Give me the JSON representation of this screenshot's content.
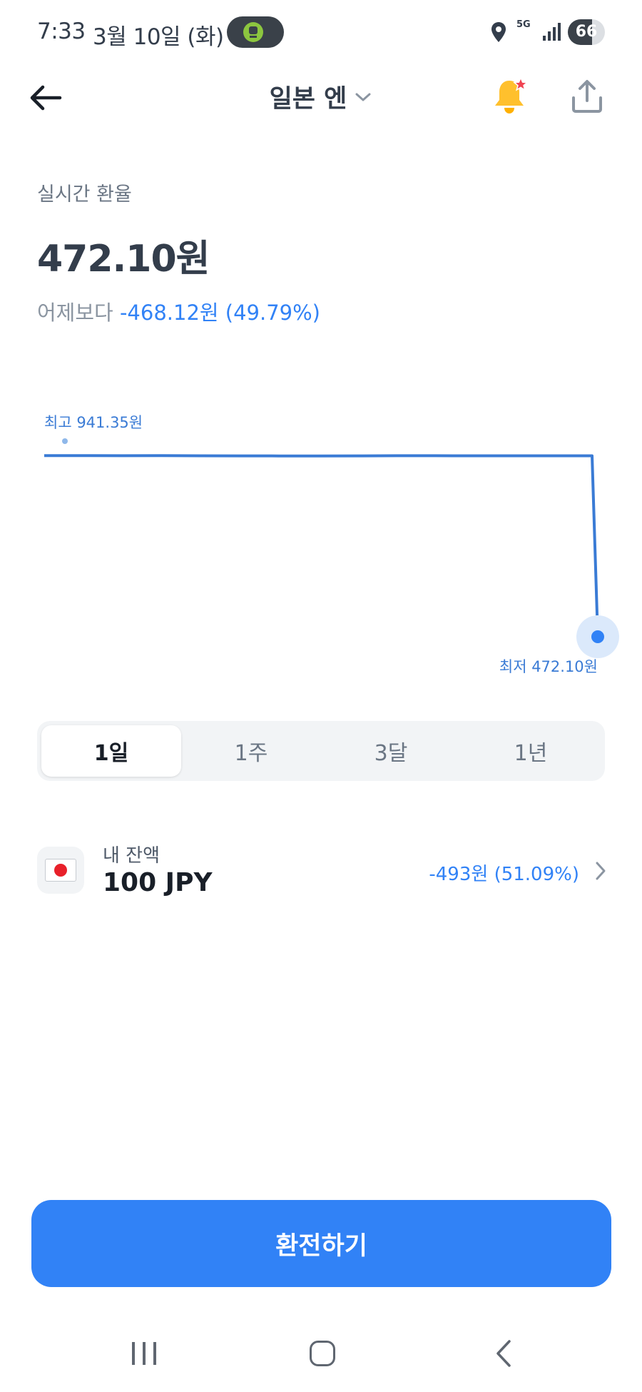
{
  "status_bar": {
    "time": "7:33",
    "date": "3월 10일 (화)",
    "network": "5G",
    "battery": "66",
    "battery_level": 0.66
  },
  "header": {
    "title": "일본 엔"
  },
  "rate": {
    "label": "실시간 환율",
    "value": "472.10원",
    "compare_label": "어제보다",
    "change": "-468.12원 (49.79%)"
  },
  "chart_data": {
    "type": "line",
    "high_label": "최고 941.35원",
    "low_label": "최저 472.10원",
    "high": 941.35,
    "low": 472.1,
    "series": [
      {
        "values": [
          940.9,
          941.0,
          940.6,
          940.8,
          940.5,
          940.2,
          940.1,
          940.1,
          940.3,
          940.6,
          940.7,
          940.5,
          940.4,
          940.5,
          940.4,
          472.1
        ]
      }
    ],
    "line_color": "#3a7bd5"
  },
  "tabs": [
    {
      "label": "1일",
      "active": true
    },
    {
      "label": "1주",
      "active": false
    },
    {
      "label": "3달",
      "active": false
    },
    {
      "label": "1년",
      "active": false
    }
  ],
  "balance": {
    "label": "내 잔액",
    "amount": "100 JPY",
    "change": "-493원 (51.09%)"
  },
  "actions": {
    "exchange_label": "환전하기"
  },
  "colors": {
    "accent": "#3182f6",
    "text_primary": "#333d4b",
    "text_secondary": "#6b7684"
  }
}
